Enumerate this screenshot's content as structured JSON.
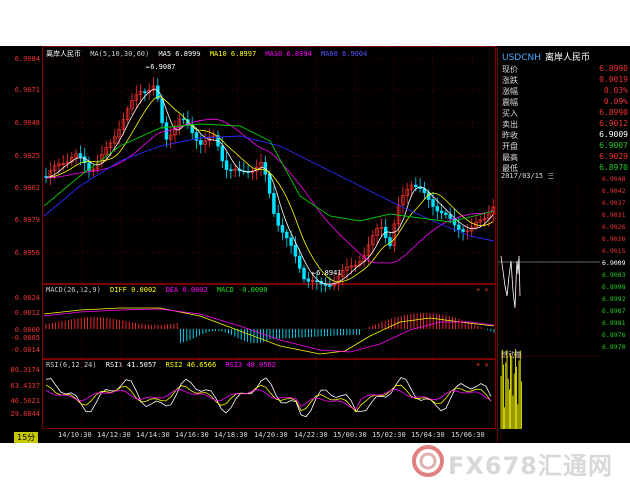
{
  "instrument": {
    "code": "USDCNH",
    "name": "离岸人民币",
    "title": "离岸人民币"
  },
  "main_legend": {
    "ma_params": "MA(5,10,30,60)",
    "ma5": "MA5 6.8999",
    "ma10": "MA10 6.8997",
    "ma30": "MA30 6.8994",
    "ma60": "MA60 6.9004"
  },
  "main_axis": [
    "6.9084",
    "6.9071",
    "6.9048",
    "6.9025",
    "6.9002",
    "6.8979",
    "6.8956"
  ],
  "main_annotations": {
    "high": "6.9087",
    "low": "6.8941"
  },
  "macd_legend": {
    "params": "MACD(26,12,9)",
    "diff": "DIFF 0.0002",
    "dea": "DEA 0.0002",
    "macd": "MACD -0.0000"
  },
  "macd_axis": [
    "0.0024",
    "0.0012",
    "0.0000",
    "-0.0005",
    "-0.0014"
  ],
  "rsi_legend": {
    "params": "RSI(6,12,24)",
    "rsi1": "RSI1 41.5057",
    "rsi2": "RSI2 46.6566",
    "rsi3": "RSI3 48.0562"
  },
  "rsi_axis": [
    "80.3174",
    "63.4337",
    "46.5021",
    "29.8844"
  ],
  "time_axis": [
    "14/10:30",
    "14/12:30",
    "14/14:30",
    "14/16:30",
    "14/18:30",
    "14/20:30",
    "14/22:30",
    "15/00:30",
    "15/02:30",
    "15/04:30",
    "15/06:30"
  ],
  "timeframe": "15分",
  "quote": [
    {
      "label": "现价",
      "value": "6.8990",
      "color": "#e33"
    },
    {
      "label": "涨跌",
      "value": "0.0019",
      "color": "#e33"
    },
    {
      "label": "涨幅",
      "value": "0.03%",
      "color": "#e33"
    },
    {
      "label": "震幅",
      "value": "0.09%",
      "color": "#e33"
    },
    {
      "label": "买入",
      "value": "6.8990",
      "color": "#e33"
    },
    {
      "label": "卖出",
      "value": "6.9012",
      "color": "#e33"
    },
    {
      "label": "昨收",
      "value": "6.9009",
      "color": "#fff"
    },
    {
      "label": "开盘",
      "value": "6.9007",
      "color": "#2c2"
    },
    {
      "label": "最高",
      "value": "6.9029",
      "color": "#e33"
    },
    {
      "label": "最低",
      "value": "6.8970",
      "color": "#2c2"
    }
  ],
  "intraday": {
    "date": "2017/03/15 三",
    "axis": [
      "6.9048",
      "6.9042",
      "6.9037",
      "6.9031",
      "6.9026",
      "6.9020",
      "6.9015",
      "6.9009",
      "6.9003",
      "6.8998",
      "6.8992",
      "6.8987",
      "6.8981",
      "6.8976",
      "6.8970"
    ],
    "prev_close": "6.9009",
    "volume_label": "跳动量"
  },
  "watermark": "FX678汇通网",
  "colors": {
    "up": "#ff3030",
    "down": "#00e0ff",
    "ma5": "#ffffff",
    "ma10": "#ffff00",
    "ma30": "#ff00ff",
    "ma60": "#2a2aff",
    "green": "#00c800"
  }
}
